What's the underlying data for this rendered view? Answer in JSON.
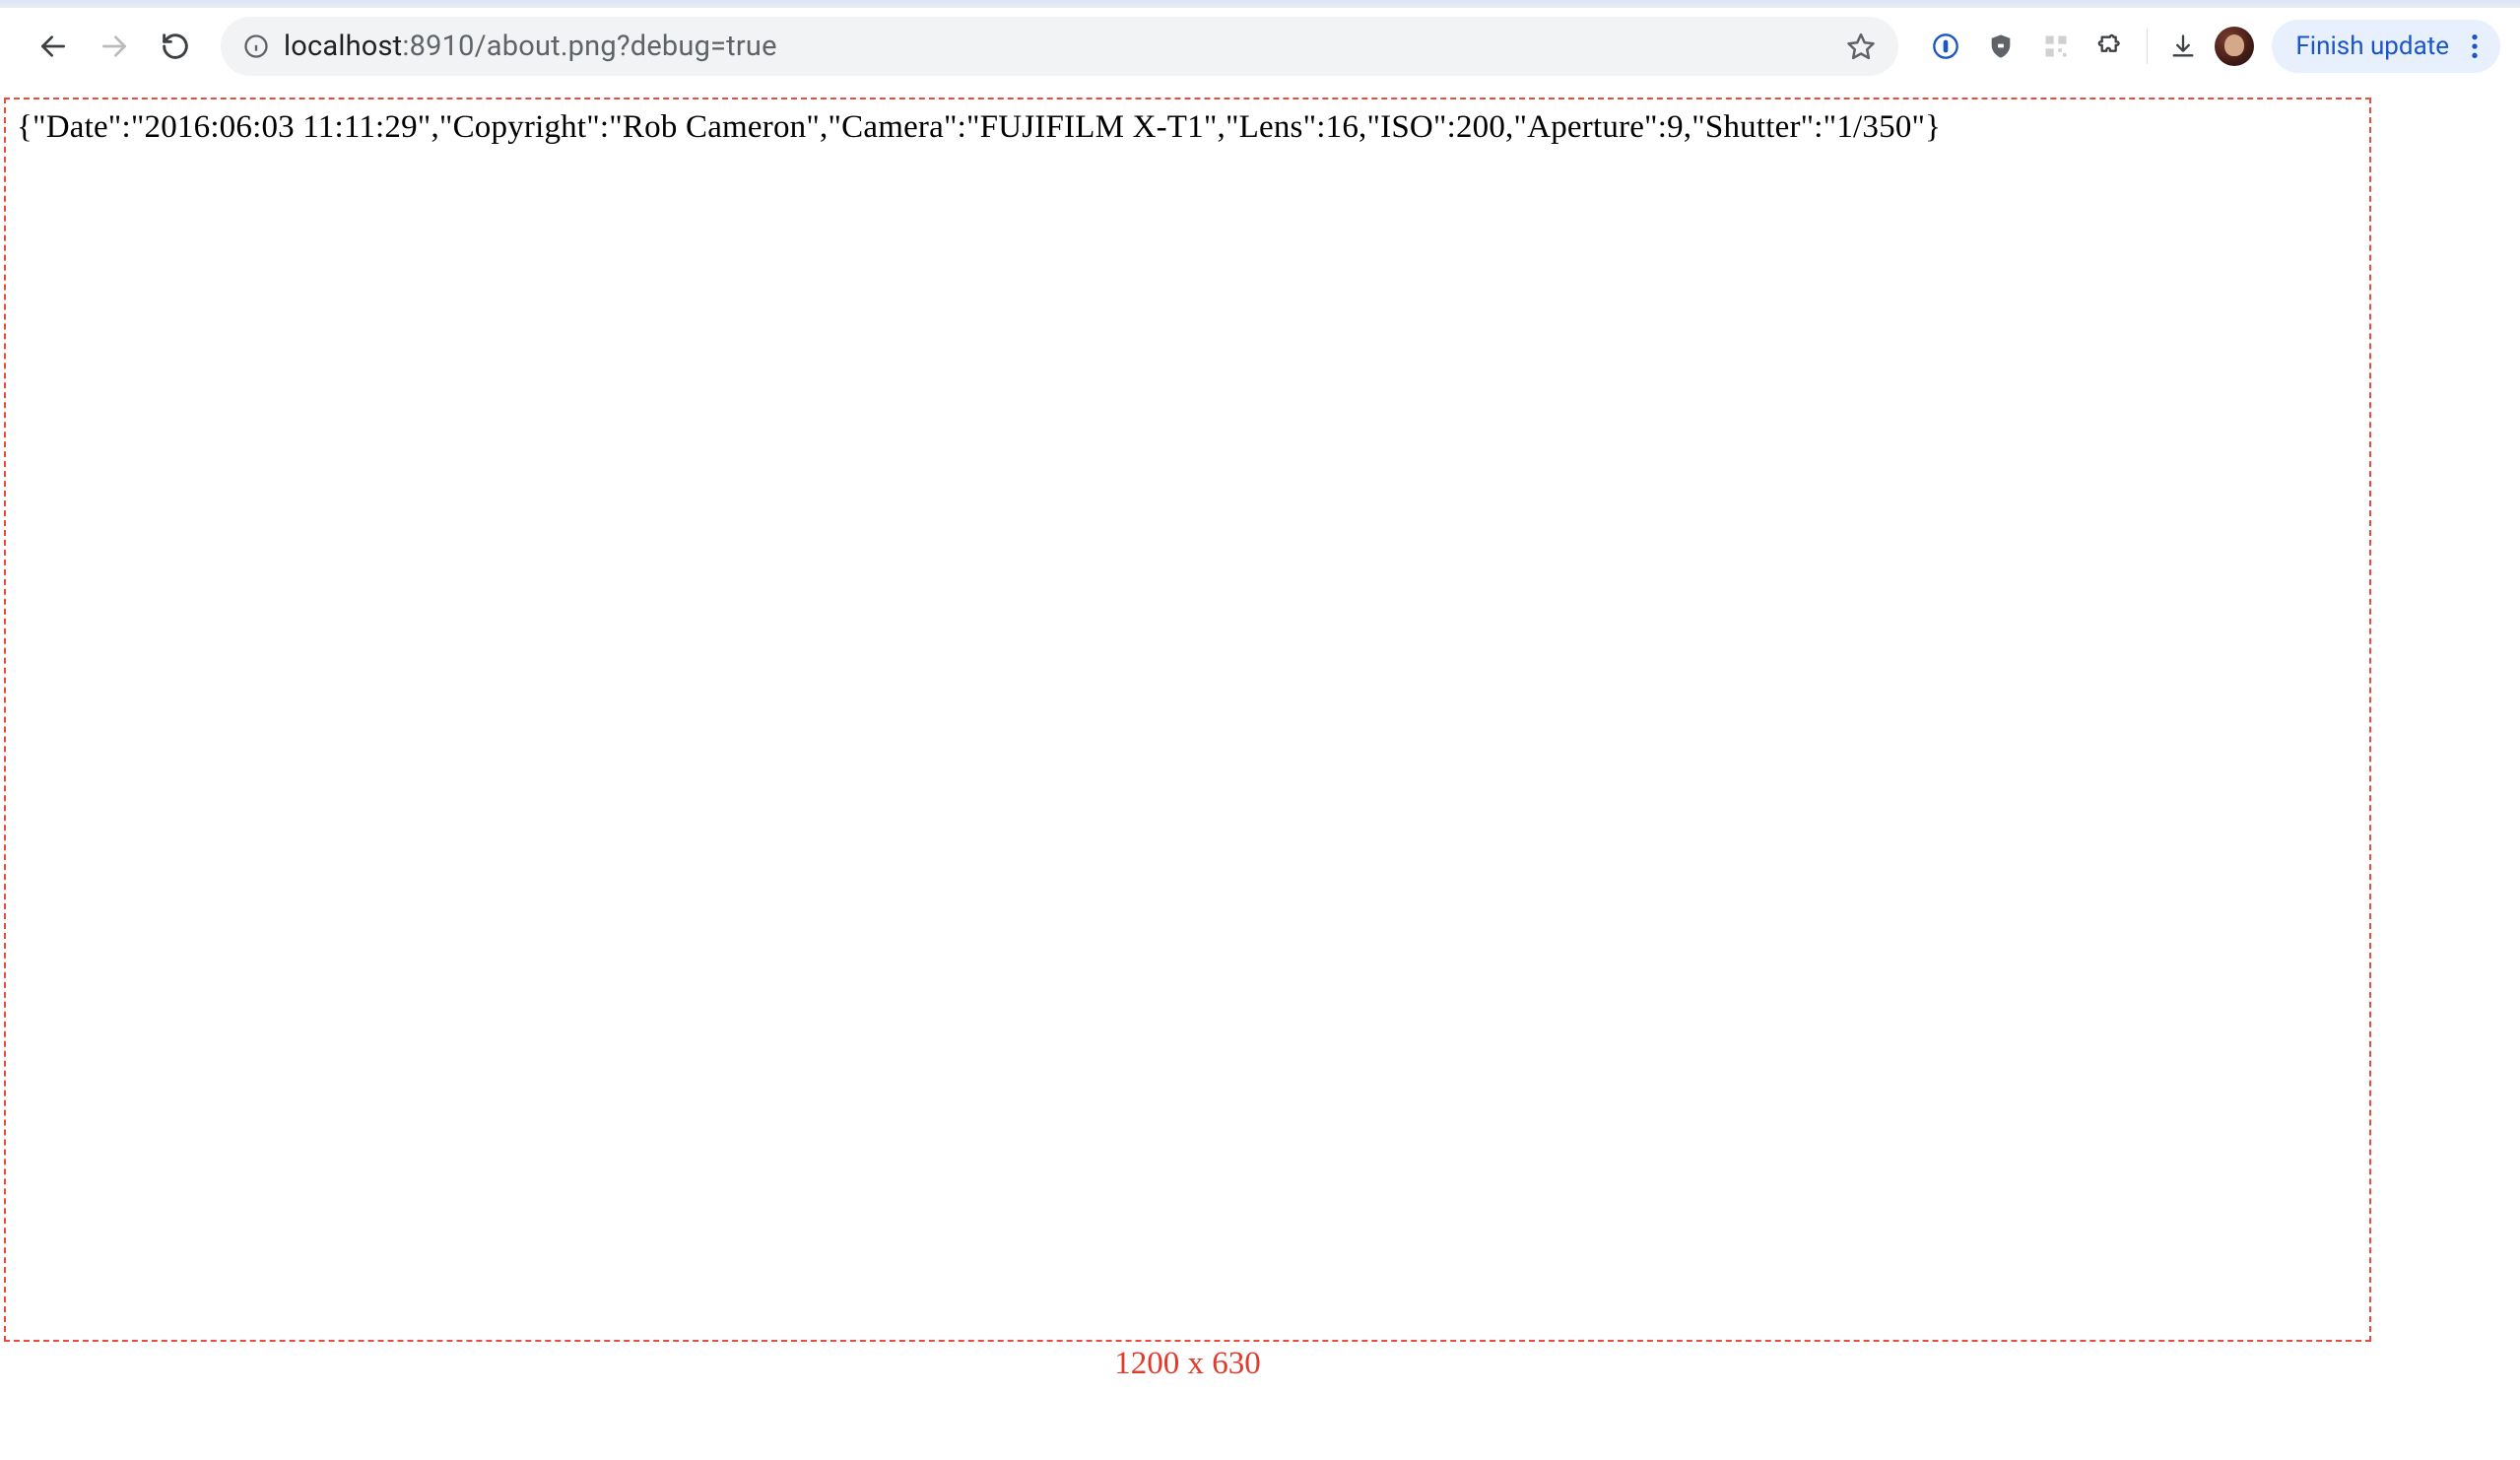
{
  "toolbar": {
    "url_host": "localhost",
    "url_port_path": ":8910/about.png?debug=true",
    "update_label": "Finish update"
  },
  "page": {
    "json_text": "{\"Date\":\"2016:06:03 11:11:29\",\"Copyright\":\"Rob Cameron\",\"Camera\":\"FUJIFILM X-T1\",\"Lens\":16,\"ISO\":200,\"Aperture\":9,\"Shutter\":\"1/350\"}",
    "dimensions_label": "1200 x 630"
  }
}
